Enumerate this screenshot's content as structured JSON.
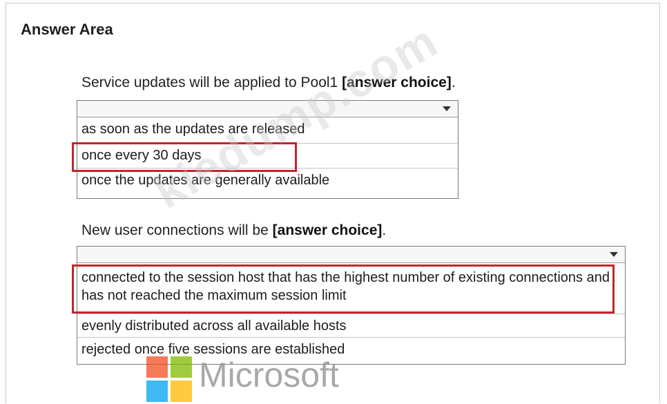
{
  "answer_area": {
    "title": "Answer Area"
  },
  "question1": {
    "prefix": "Service updates will be applied to Pool1 ",
    "choice_label": "[answer choice]",
    "suffix": ".",
    "options": [
      "as soon as the updates are released",
      "once every 30 days",
      "once the updates are generally available"
    ],
    "selected_index": 1
  },
  "question2": {
    "prefix": "New user connections will be ",
    "choice_label": "[answer choice]",
    "suffix": ".",
    "options": [
      "connected to the session host that has the highest number of existing connections and has not reached the maximum session limit",
      "evenly distributed across all available hosts",
      "rejected once five sessions are established"
    ],
    "selected_index": 0
  },
  "watermark": {
    "text": "kiedump.com"
  },
  "brand": {
    "wordmark": "Microsoft",
    "colors": {
      "red": "#f25022",
      "green": "#7fba00",
      "blue": "#00a4ef",
      "yellow": "#ffb900"
    }
  },
  "colors": {
    "highlight": "#c0262d"
  }
}
